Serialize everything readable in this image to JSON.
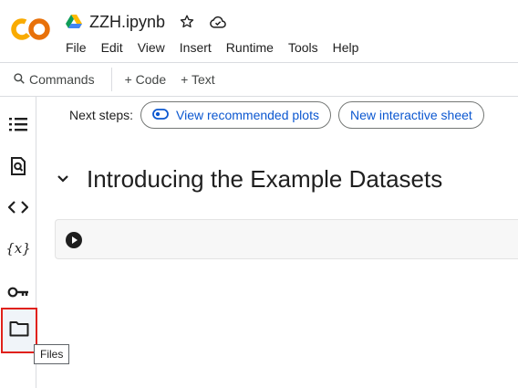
{
  "header": {
    "file_name": "ZZH.ipynb",
    "menu": [
      "File",
      "Edit",
      "View",
      "Insert",
      "Runtime",
      "Tools",
      "Help"
    ]
  },
  "toolbar": {
    "commands_label": "Commands",
    "code_label": "+ Code",
    "text_label": "+ Text"
  },
  "rail": {
    "icons": [
      "table-of-contents-icon",
      "find-icon",
      "code-snippets-icon",
      "variables-icon",
      "secrets-key-icon",
      "files-folder-icon"
    ],
    "tooltip": "Files"
  },
  "main": {
    "next_steps_label": "Next steps:",
    "chips": [
      "View recommended plots",
      "New interactive sheet"
    ],
    "section_title": "Introducing the Example Datasets"
  },
  "colors": {
    "accent_blue": "#0b57d0",
    "logo_orange": "#f9ab00",
    "logo_dark_orange": "#e8710a",
    "highlight_red": "#e0211b",
    "border": "#dadce0"
  }
}
